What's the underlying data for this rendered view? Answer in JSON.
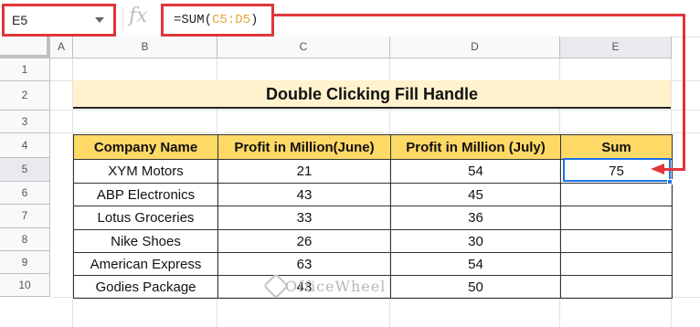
{
  "formula_bar": {
    "name_box": "E5",
    "fx_icon": "fx-icon",
    "formula_prefix": "=SUM(",
    "formula_ref": "C5:D5",
    "formula_suffix": ")"
  },
  "columns": [
    "A",
    "B",
    "C",
    "D",
    "E"
  ],
  "rows": [
    "1",
    "2",
    "3",
    "4",
    "5",
    "6",
    "7",
    "8",
    "9",
    "10"
  ],
  "title": "Double Clicking Fill Handle",
  "table": {
    "headers": [
      "Company Name",
      "Profit in Million(June)",
      "Profit in Million (July)",
      "Sum"
    ],
    "rows": [
      [
        "XYM Motors",
        "21",
        "54",
        "75"
      ],
      [
        "ABP Electronics",
        "43",
        "45",
        ""
      ],
      [
        "Lotus Groceries",
        "33",
        "36",
        ""
      ],
      [
        "Nike Shoes",
        "26",
        "30",
        ""
      ],
      [
        "American Express",
        "63",
        "54",
        ""
      ],
      [
        "Godies Package",
        "43",
        "50",
        ""
      ]
    ]
  },
  "watermark": "OfficeWheel",
  "colors": {
    "accent_red": "#e0363b",
    "header_fill": "#ffd966",
    "title_fill": "#fff2cc",
    "selection": "#1a73e8"
  }
}
